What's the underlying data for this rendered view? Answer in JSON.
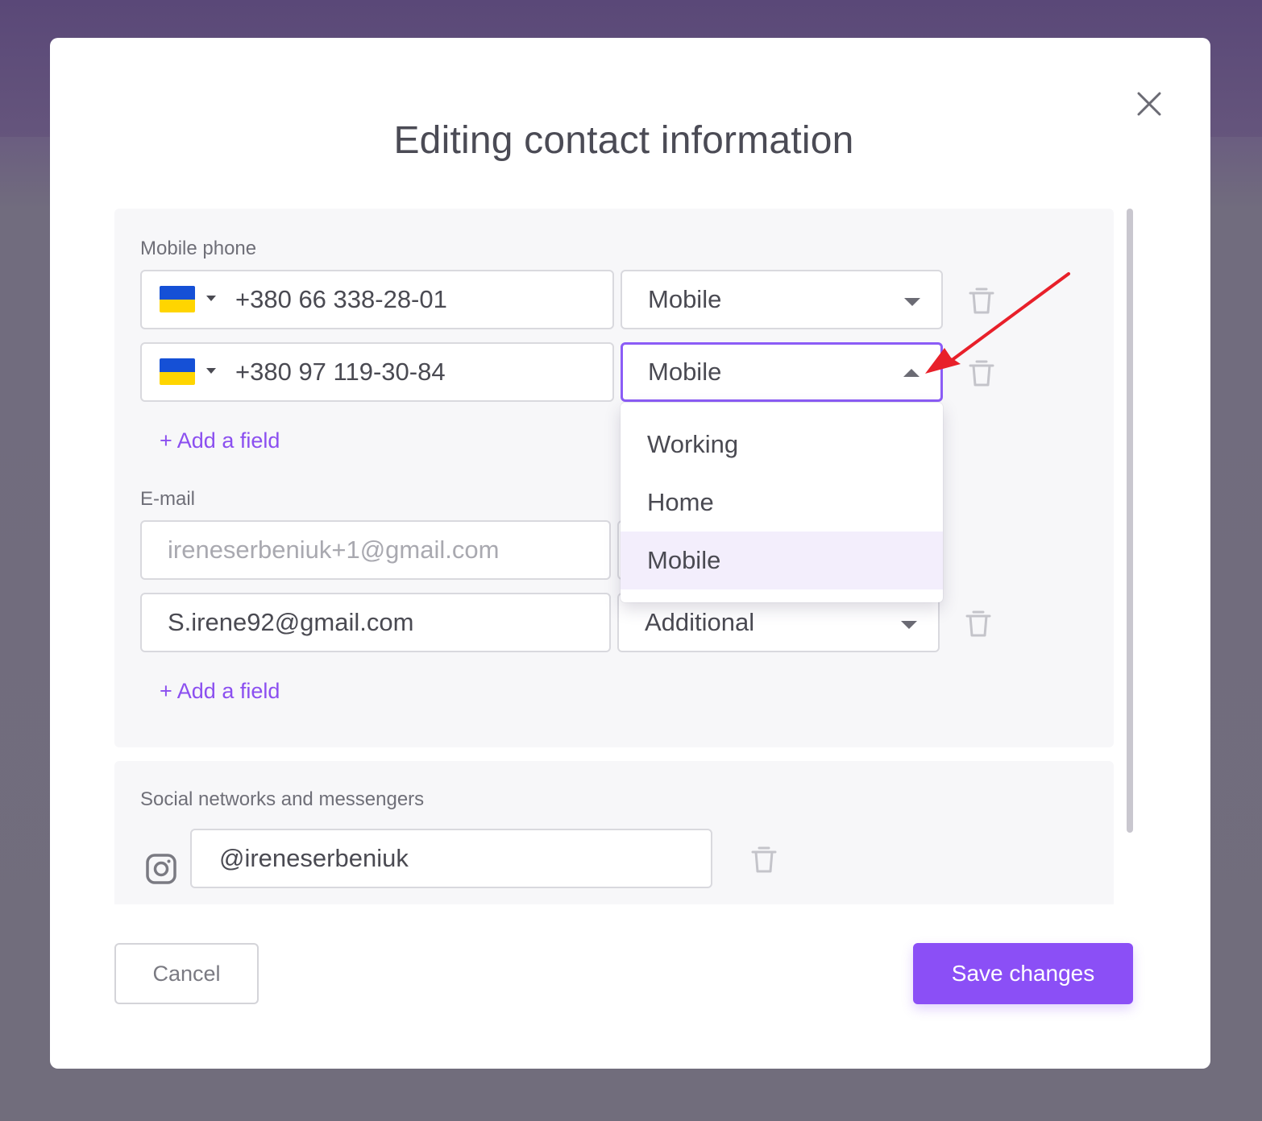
{
  "modal": {
    "title": "Editing contact information"
  },
  "contacts": {
    "phone_label": "Mobile phone",
    "phones": [
      {
        "number": "+380 66 338-28-01",
        "type": "Mobile"
      },
      {
        "number": "+380 97 119-30-84",
        "type": "Mobile"
      }
    ],
    "add_field": "+ Add a field",
    "email_label": "E-mail",
    "emails": [
      {
        "value": "ireneserbeniuk+1@gmail.com"
      },
      {
        "value": "S.irene92@gmail.com",
        "type": "Additional"
      }
    ],
    "add_email_field": "+ Add a field"
  },
  "dropdown": {
    "options": [
      "Working",
      "Home",
      "Mobile"
    ],
    "selected": "Mobile"
  },
  "social": {
    "label": "Social networks and messengers",
    "instagram": "@ireneserbeniuk"
  },
  "footer": {
    "cancel_label": "Cancel",
    "save_label": "Save changes"
  },
  "colors": {
    "accent": "#8b4ff6",
    "annotation_arrow": "#e8202a",
    "flag_blue": "#1550d6",
    "flag_yellow": "#ffd500"
  },
  "icons": [
    "close-icon",
    "chevron-down-icon",
    "chevron-up-icon",
    "trash-icon",
    "instagram-icon",
    "flag-ua-icon",
    "annotation-arrow"
  ]
}
